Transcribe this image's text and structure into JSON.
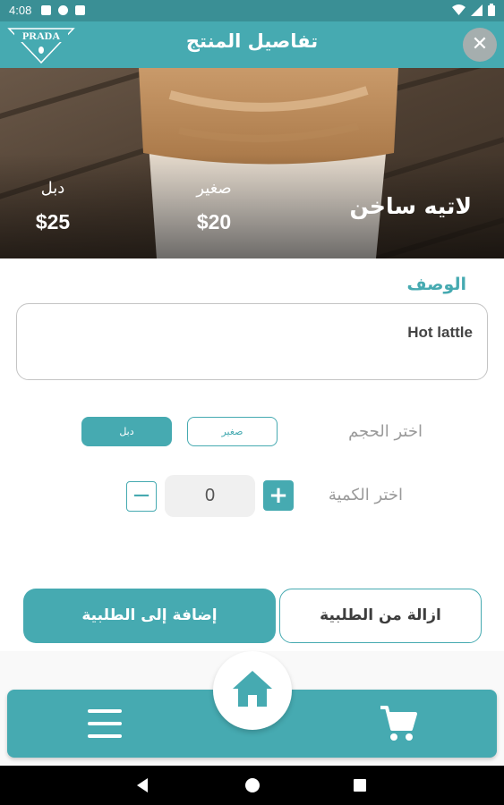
{
  "status_bar": {
    "time": "4:08"
  },
  "app_bar": {
    "title": "تفاصيل المنتج",
    "logo_text": "PRADA",
    "close_icon": "close-icon"
  },
  "product": {
    "name": "لاتيه ساخن",
    "sizes": [
      {
        "label": "صغير",
        "price": "$20"
      },
      {
        "label": "دبل",
        "price": "$25"
      }
    ]
  },
  "description": {
    "label": "الوصف",
    "text": "Hot lattle"
  },
  "size_picker": {
    "label": "اختر الحجم",
    "options": [
      "صغير",
      "دبل"
    ],
    "selected": "دبل"
  },
  "quantity": {
    "label": "اختر الكمية",
    "value": "0",
    "plus": "+",
    "minus": "−"
  },
  "actions": {
    "remove_label": "ازالة من الطلبية",
    "add_label": "إضافة إلى الطلبية"
  },
  "bottom_nav": {
    "items": [
      "menu-icon",
      "home-icon",
      "cart-icon"
    ]
  },
  "colors": {
    "primary": "#46aab1",
    "status_bar": "#3a8f95",
    "close_button": "#a5aeae"
  }
}
